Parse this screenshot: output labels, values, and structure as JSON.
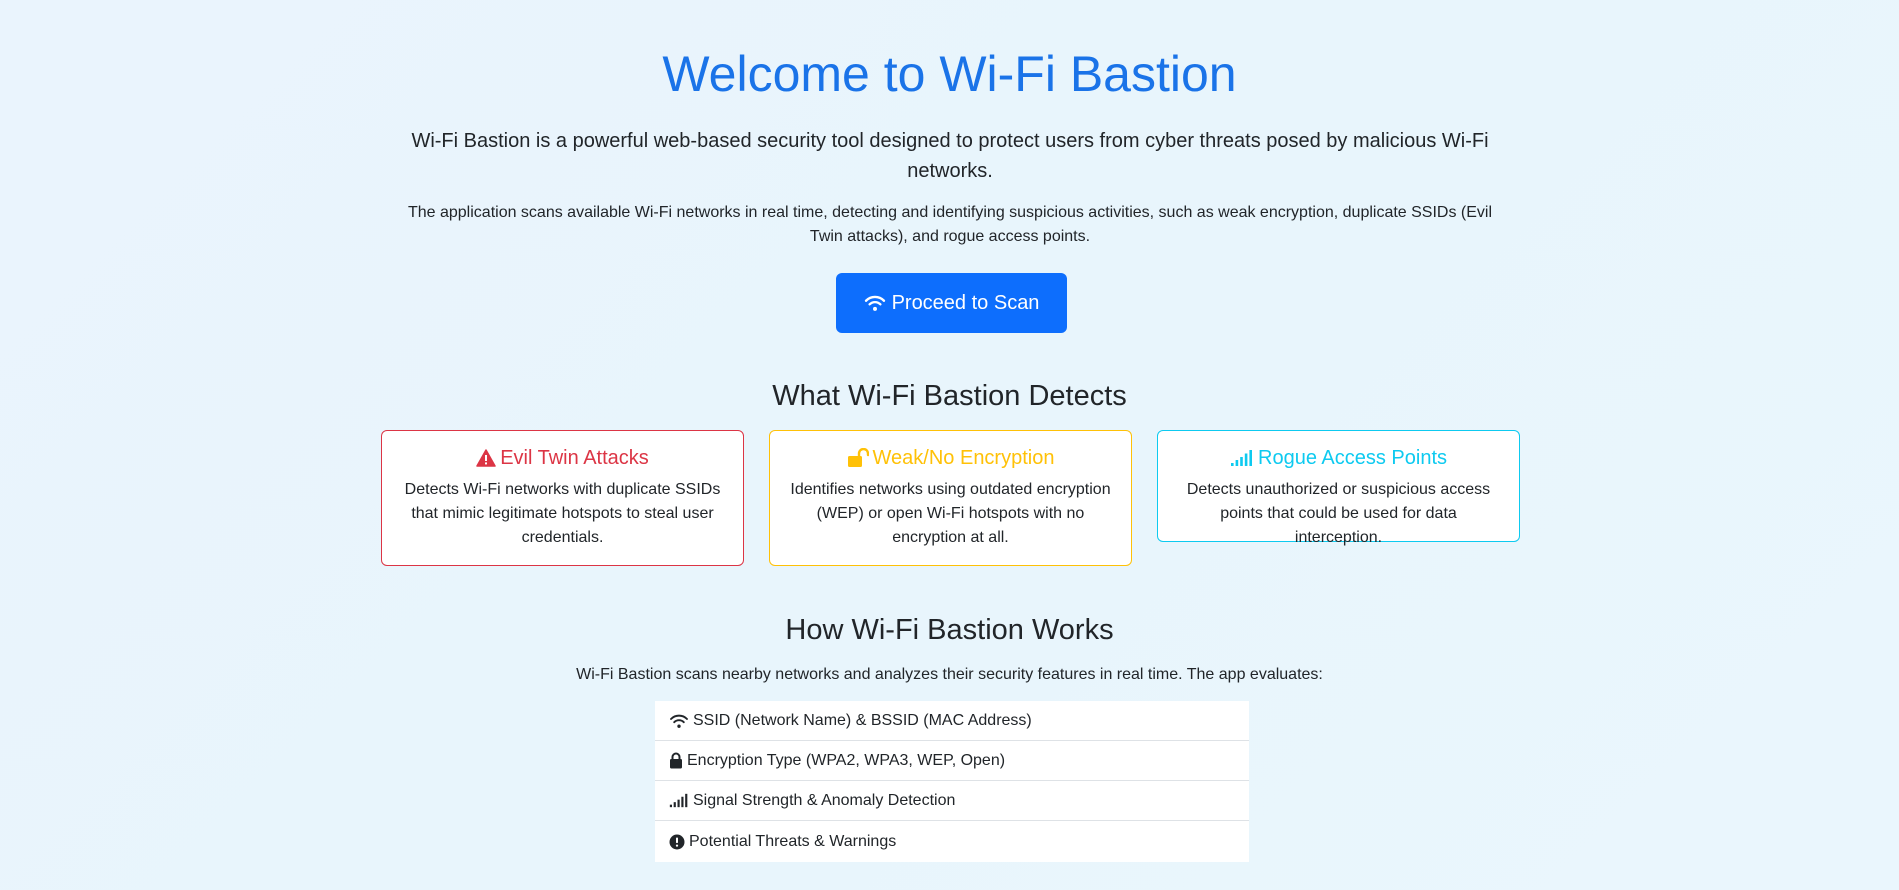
{
  "hero": {
    "title": "Welcome to Wi-Fi Bastion",
    "lead": "Wi-Fi Bastion is a powerful web-based security tool designed to protect users from cyber threats posed by malicious Wi-Fi networks.",
    "description": "The application scans available Wi-Fi networks in real time, detecting and identifying suspicious activities, such as weak encryption, duplicate SSIDs (Evil Twin attacks), and rogue access points.",
    "button_label": "Proceed to Scan",
    "button_icon": "wifi-icon"
  },
  "detects": {
    "title": "What Wi-Fi Bastion Detects",
    "cards": [
      {
        "icon": "warning-triangle-icon",
        "title": "Evil Twin Attacks",
        "text": "Detects Wi-Fi networks with duplicate SSIDs that mimic legitimate hotspots to steal user credentials.",
        "color": "#dc3545"
      },
      {
        "icon": "unlock-icon",
        "title": "Weak/No Encryption",
        "text": "Identifies networks using outdated encryption (WEP) or open Wi-Fi hotspots with no encryption at all.",
        "color": "#ffc107"
      },
      {
        "icon": "signal-bars-icon",
        "title": "Rogue Access Points",
        "text": "Detects unauthorized or suspicious access points that could be used for data interception.",
        "color": "#0dcaf0"
      }
    ]
  },
  "works": {
    "title": "How Wi-Fi Bastion Works",
    "description": "Wi-Fi Bastion scans nearby networks and analyzes their security features in real time. The app evaluates:",
    "items": [
      {
        "icon": "wifi-icon",
        "label": "SSID (Network Name) & BSSID (MAC Address)"
      },
      {
        "icon": "lock-icon",
        "label": "Encryption Type (WPA2, WPA3, WEP, Open)"
      },
      {
        "icon": "signal-bars-icon",
        "label": "Signal Strength & Anomaly Detection"
      },
      {
        "icon": "exclamation-circle-icon",
        "label": "Potential Threats & Warnings"
      }
    ]
  },
  "colors": {
    "primary": "#0d6efd",
    "title_blue": "#1a73e8",
    "danger": "#dc3545",
    "warning": "#ffc107",
    "info": "#0dcaf0"
  }
}
